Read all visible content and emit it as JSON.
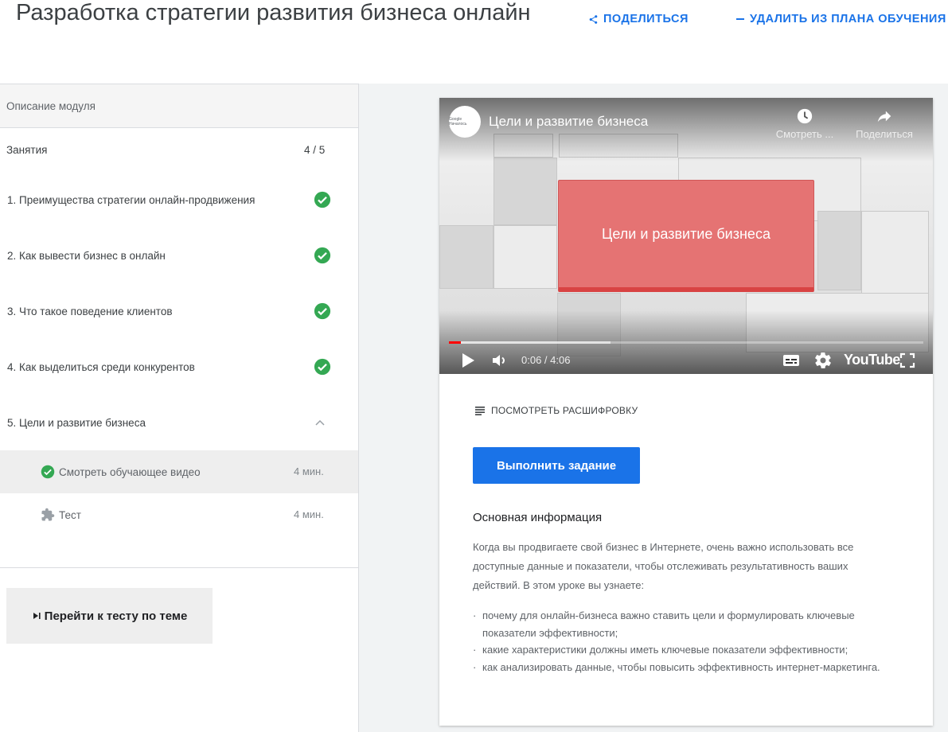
{
  "header": {
    "title": "Разработка стратегии развития бизнеса онлайн",
    "share_label": "ПОДЕЛИТЬСЯ",
    "remove_label": "УДАЛИТЬ ИЗ ПЛАНА ОБУЧЕНИЯ"
  },
  "sidebar": {
    "module_description": "Описание модуля",
    "lessons_label": "Занятия",
    "lessons_count": "4 / 5",
    "lessons": [
      {
        "label": "1. Преимущества стратегии онлайн-продвижения",
        "status": "completed"
      },
      {
        "label": "2. Как вывести бизнес в онлайн",
        "status": "completed"
      },
      {
        "label": "3. Что такое поведение клиентов",
        "status": "completed"
      },
      {
        "label": "4. Как выделиться среди конкурентов",
        "status": "completed"
      },
      {
        "label": "5. Цели и развитие бизнеса",
        "status": "expanded"
      }
    ],
    "subitems": [
      {
        "label": "Смотреть обучающее видео",
        "duration": "4 мин.",
        "icon": "check-circle-icon",
        "active": true
      },
      {
        "label": "Тест",
        "duration": "4 мин.",
        "icon": "puzzle-icon",
        "active": false
      }
    ],
    "goto_test_label": "Перейти к тесту по теме"
  },
  "video": {
    "title": "Цели и развитие бизнеса",
    "watch_later_label": "Смотреть ...",
    "share_label": "Поделиться",
    "card_text": "Цели и развитие бизнеса",
    "time": "0:06 / 4:06",
    "progress": 0.025,
    "buffered": 0.34,
    "logo_text": "YouTube",
    "channel_logo_text": "Google Началось"
  },
  "content": {
    "transcript_label": "ПОСМОТРЕТЬ РАСШИФРОВКУ",
    "do_task_label": "Выполнить задание",
    "info_title": "Основная информация",
    "info_text": "Когда вы продвигаете свой бизнес в Интернете, очень важно использовать все доступные данные и показатели, чтобы отслеживать результативность ваших действий. В этом уроке вы узнаете:",
    "bullets": [
      "почему для онлайн-бизнеса важно ставить цели и формулировать ключевые показатели эффективности;",
      "какие характеристики должны иметь ключевые показатели эффективности;",
      "как анализировать данные, чтобы повысить эффективность интернет-маркетинга."
    ]
  },
  "colors": {
    "accent": "#1a73e8",
    "success": "#34a853",
    "youtube_red": "#ff0000"
  }
}
